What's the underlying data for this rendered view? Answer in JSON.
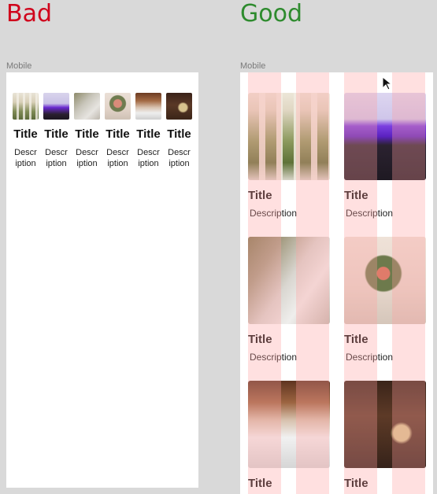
{
  "bad": {
    "heading": "Bad",
    "heading_color": "#d0021b",
    "frame_label": "Mobile"
  },
  "good": {
    "heading": "Good",
    "heading_color": "#2e8b2e",
    "frame_label": "Mobile"
  },
  "cards": [
    {
      "title": "Title",
      "description": "Description",
      "image": "pavilion-photo"
    },
    {
      "title": "Title",
      "description": "Description",
      "image": "turnstile-photo"
    },
    {
      "title": "Title",
      "description": "Description",
      "image": "banquet-table-photo"
    },
    {
      "title": "Title",
      "description": "Description",
      "image": "centerpiece-photo"
    },
    {
      "title": "Title",
      "description": "Description",
      "image": "wedding-hall-photo"
    },
    {
      "title": "Title",
      "description": "Description",
      "image": "chandelier-hall-photo"
    }
  ],
  "bad_desc_lines": [
    "Descr",
    "iption"
  ],
  "colors": {
    "grid_overlay": "#ffa0a0",
    "page_bg": "#d9d9d9"
  }
}
